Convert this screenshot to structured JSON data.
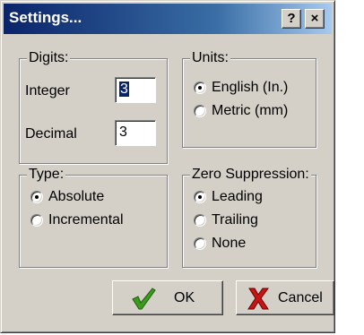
{
  "window": {
    "title": "Settings...",
    "help_label": "?",
    "close_label": "×"
  },
  "digits": {
    "legend": "Digits:",
    "integer_label": "Integer",
    "integer_value": "3",
    "decimal_label": "Decimal",
    "decimal_value": "3"
  },
  "units": {
    "legend": "Units:",
    "options": [
      {
        "label": "English (In.)",
        "checked": true
      },
      {
        "label": "Metric (mm)",
        "checked": false
      }
    ]
  },
  "type": {
    "legend": "Type:",
    "options": [
      {
        "label": "Absolute",
        "checked": true
      },
      {
        "label": "Incremental",
        "checked": false
      }
    ]
  },
  "zero_suppression": {
    "legend": "Zero Suppression:",
    "options": [
      {
        "label": "Leading",
        "checked": true
      },
      {
        "label": "Trailing",
        "checked": false
      },
      {
        "label": "None",
        "checked": false
      }
    ]
  },
  "buttons": {
    "ok_label": "OK",
    "ok_icon": "checkmark-icon",
    "cancel_label": "Cancel",
    "cancel_icon": "x-cross-icon"
  },
  "colors": {
    "title_bar": "#0a246a",
    "face": "#d4d0c8",
    "check_green": "#3c9a1e",
    "cancel_red": "#c81414"
  }
}
